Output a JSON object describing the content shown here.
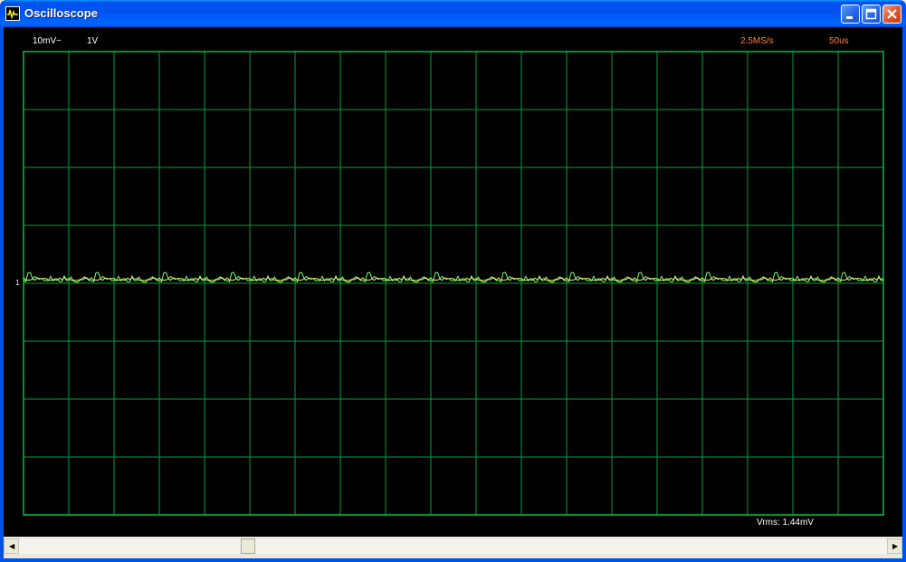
{
  "window": {
    "title": "Oscilloscope"
  },
  "scope": {
    "volts_per_div": "10mV~",
    "ch2_scale": "1V",
    "sample_rate": "2.5MS/s",
    "time_per_div": "50us",
    "vrms": "Vrms: 1.44mV",
    "marker": "1",
    "grid": {
      "cols": 19,
      "rows": 8
    },
    "colors": {
      "grid": "#00a040",
      "frame": "#00c040",
      "trace1": "#e0ff60",
      "trace2": "#80ff80",
      "bg": "#000000",
      "label": "#ffffff",
      "accent": "#ff8040"
    }
  },
  "chart_data": {
    "type": "line",
    "series": [
      {
        "values": [
          0,
          1,
          -1,
          2,
          0,
          -2,
          1,
          3,
          -1,
          0,
          4,
          1,
          -2,
          2,
          0,
          5,
          -1,
          1,
          0,
          -3,
          2,
          1,
          6,
          -1,
          0,
          2,
          -2,
          1,
          3,
          0
        ]
      },
      {
        "values": [
          0,
          0.3,
          -0.4,
          0.5,
          0.1,
          -0.5,
          0.4,
          0.2,
          -0.3,
          0.6,
          0.0,
          -0.2,
          0.3,
          0.1,
          -0.4,
          0.5,
          -0.1,
          0.2,
          -0.3,
          0.4,
          0.0,
          -0.5,
          0.3,
          0.2,
          -0.1,
          0.4,
          -0.3,
          0.1,
          0.2,
          0.0
        ]
      }
    ]
  },
  "scroll": {
    "thumb_position": 0.26
  }
}
